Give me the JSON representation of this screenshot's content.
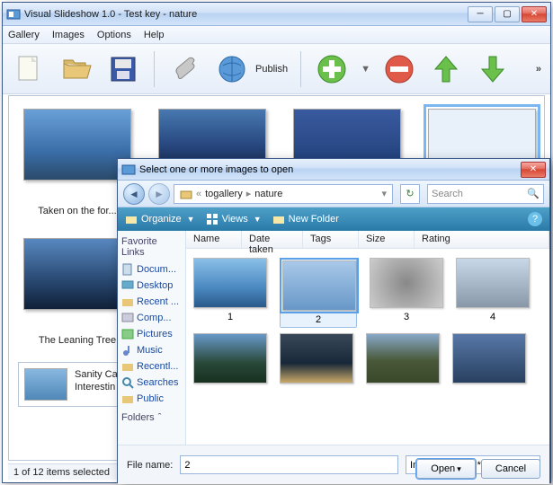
{
  "main": {
    "title": "Visual Slideshow 1.0 - Test key - nature",
    "menu": {
      "gallery": "Gallery",
      "images": "Images",
      "options": "Options",
      "help": "Help"
    },
    "publish": "Publish",
    "thumbs": [
      {
        "caption": "Taken on the for..."
      },
      {
        "caption": ""
      },
      {
        "caption": ""
      },
      {
        "caption": ""
      }
    ],
    "thumbs2": [
      {
        "caption": "The Leaning Tree"
      }
    ],
    "detail": {
      "line1": "Sanity Ca",
      "line2": "Interestin"
    },
    "status": "1 of 12 items selected"
  },
  "dialog": {
    "title": "Select one or more images to open",
    "crumb": {
      "p1": "togallery",
      "p2": "nature"
    },
    "search_ph": "Search",
    "orgbar": {
      "organize": "Organize",
      "views": "Views",
      "newfolder": "New Folder"
    },
    "favs": {
      "header": "Favorite Links",
      "items": [
        "Docum...",
        "Desktop",
        "Recent ...",
        "Comp...",
        "Pictures",
        "Music",
        "Recentl...",
        "Searches",
        "Public"
      ],
      "folders": "Folders"
    },
    "cols": {
      "name": "Name",
      "date": "Date taken",
      "tags": "Tags",
      "size": "Size",
      "rating": "Rating"
    },
    "grid": [
      "1",
      "2",
      "3",
      "4",
      "",
      "",
      "",
      ""
    ],
    "filename_label": "File name:",
    "filename_value": "2",
    "filetype": "Images (*.bmp *.dib *.rle *.jpg *",
    "open": "Open",
    "cancel": "Cancel"
  }
}
